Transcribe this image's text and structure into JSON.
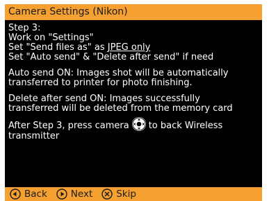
{
  "title": "Camera Settings (Nikon)",
  "step_block": {
    "step": "Step 3:",
    "line1": "Work on \"Settings\"",
    "line2_prefix": "Set \"Send files as\" as ",
    "line2_value": "JPEG only",
    "line3": "Set \"Auto send\" & \"Delete after send\" if need"
  },
  "auto_send_block": {
    "line1": "Auto send ON: Images shot will be automatically",
    "line2": "transferred to printer for photo finishing."
  },
  "delete_block": {
    "line1": "Delete after send ON: Images successfully",
    "line2": "transferred will be deleted from the memory card"
  },
  "after_block": {
    "line1_prefix": "After Step 3, press camera",
    "line1_suffix": "to back Wireless",
    "line2": "transmitter"
  },
  "nav": {
    "back": "Back",
    "next": "Next",
    "skip": "Skip"
  },
  "colors": {
    "accent": "#f5a031",
    "background": "#000000",
    "text": "#ffffff"
  },
  "icons": {
    "back": "circle-left-arrow-icon",
    "next": "circle-right-arrow-icon",
    "skip": "circle-x-icon",
    "camera_button": "camera-multi-selector-icon"
  }
}
